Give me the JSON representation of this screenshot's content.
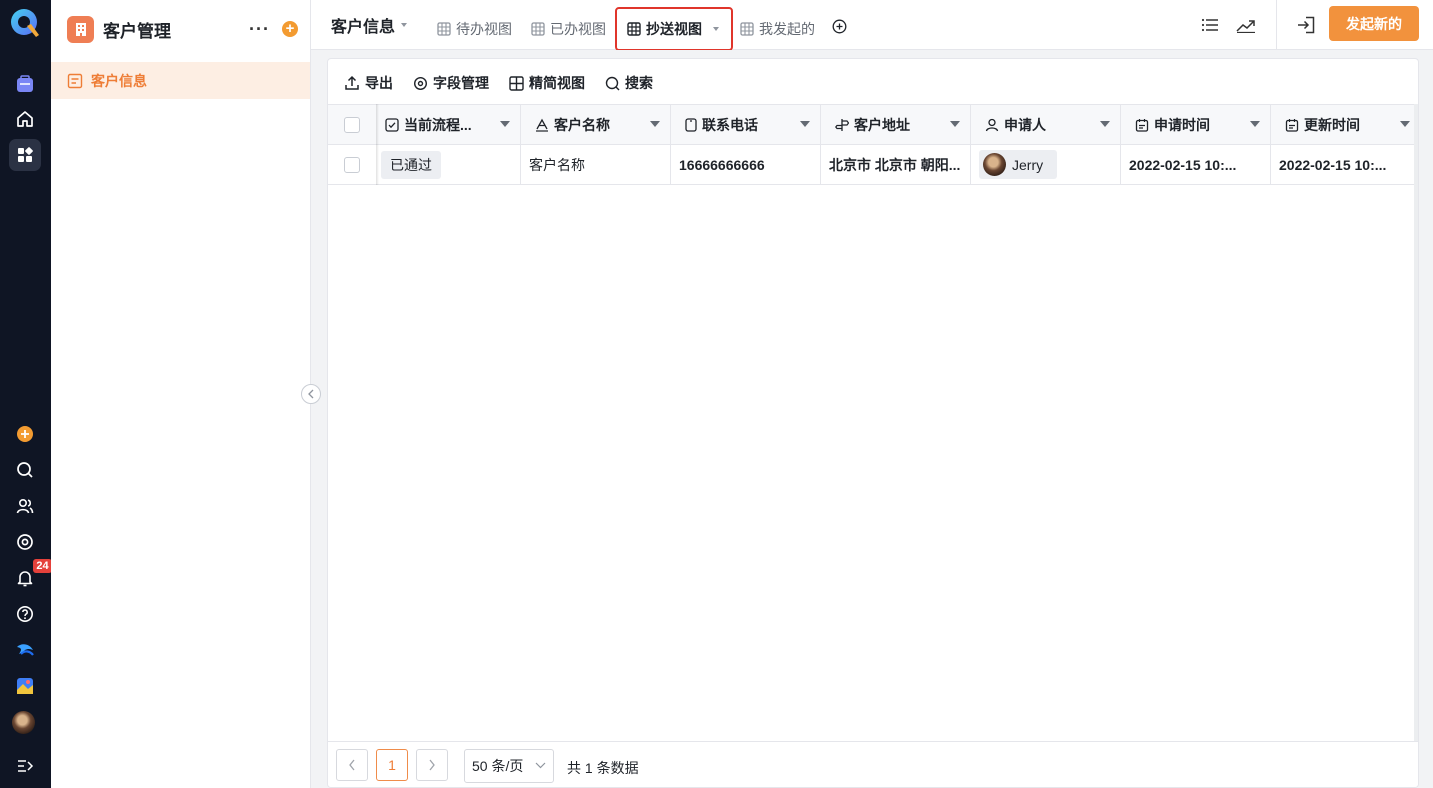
{
  "rail": {
    "notification_count": "24"
  },
  "sidebar": {
    "app_title": "客户管理",
    "more_label": "···",
    "add_label": "+",
    "items": [
      {
        "label": "客户信息"
      }
    ]
  },
  "topbar": {
    "page_title": "客户信息",
    "tabs": [
      {
        "label": "待办视图"
      },
      {
        "label": "已办视图"
      },
      {
        "label": "抄送视图"
      },
      {
        "label": "我发起的"
      }
    ],
    "active_tab": "抄送视图",
    "primary_button": "发起新的"
  },
  "toolbar": {
    "export": "导出",
    "fields": "字段管理",
    "compact": "精简视图",
    "search": "搜索"
  },
  "table": {
    "columns": [
      {
        "label": "当前流程..."
      },
      {
        "label": "客户名称"
      },
      {
        "label": "联系电话"
      },
      {
        "label": "客户地址"
      },
      {
        "label": "申请人"
      },
      {
        "label": "申请时间"
      },
      {
        "label": "更新时间"
      }
    ],
    "rows": [
      {
        "status": "已通过",
        "name": "客户名称",
        "phone": "16666666666",
        "address": "北京市 北京市 朝阳...",
        "applicant": "Jerry",
        "applied_at": "2022-02-15 10:...",
        "updated_at": "2022-02-15 10:..."
      }
    ]
  },
  "pagination": {
    "current_page": "1",
    "page_size": "50 条/页",
    "total": "共 1 条数据"
  },
  "colors": {
    "accent": "#f2923d",
    "rail_bg": "#0f1524",
    "highlight": "#e0352b",
    "sidebar_active_bg": "#fdeee3"
  }
}
